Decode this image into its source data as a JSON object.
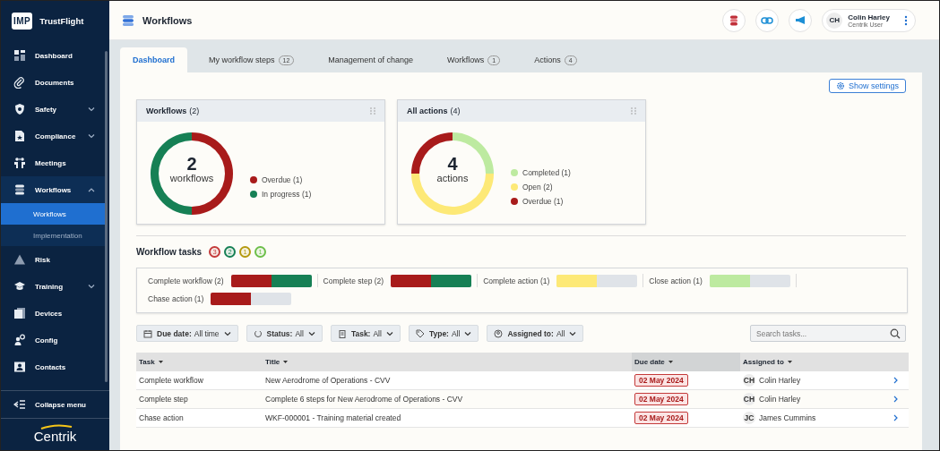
{
  "sidebar": {
    "logo": {
      "mark": "IMP",
      "name": "TrustFlight"
    },
    "items": [
      {
        "label": "Dashboard"
      },
      {
        "label": "Documents"
      },
      {
        "label": "Safety",
        "expanded": false
      },
      {
        "label": "Compliance",
        "expanded": false
      },
      {
        "label": "Meetings"
      },
      {
        "label": "Workflows",
        "expanded": true,
        "children": [
          {
            "label": "Workflows",
            "selected": true
          },
          {
            "label": "Implementation",
            "selected": false
          }
        ]
      },
      {
        "label": "Risk"
      },
      {
        "label": "Training",
        "expanded": false
      },
      {
        "label": "Devices"
      },
      {
        "label": "Config"
      },
      {
        "label": "Contacts"
      }
    ],
    "collapse": "Collapse menu",
    "brand": "Centrik"
  },
  "header": {
    "title": "Workflows",
    "user": {
      "initials": "CH",
      "name": "Colin Harley",
      "role": "Centrik User"
    }
  },
  "tabs": [
    {
      "label": "Dashboard",
      "selected": true
    },
    {
      "label": "My workflow steps",
      "count": "12",
      "selected": false
    },
    {
      "label": "Management of change",
      "selected": false
    },
    {
      "label": "Workflows",
      "count": "1",
      "selected": false
    },
    {
      "label": "Actions",
      "count": "4",
      "selected": false
    }
  ],
  "settings_button": "Show settings",
  "cards": [
    {
      "title": "Workflows",
      "count": "(2)",
      "center_value": "2",
      "center_label": "workflows",
      "chart_data": {
        "type": "donut",
        "categories": [
          "Overdue (1)",
          "In progress (1)"
        ],
        "values": [
          1,
          1
        ],
        "colors": [
          "#a81b1b",
          "#168055"
        ]
      }
    },
    {
      "title": "All actions",
      "count": "(4)",
      "center_value": "4",
      "center_label": "actions",
      "chart_data": {
        "type": "donut",
        "categories": [
          "Completed (1)",
          "Open (2)",
          "Overdue (1)"
        ],
        "values": [
          1,
          2,
          1
        ],
        "colors": [
          "#bdeaa0",
          "#fde977",
          "#a81b1b"
        ]
      }
    }
  ],
  "task_summary": {
    "title": "Workflow tasks",
    "badges": [
      {
        "count": "3",
        "color": "#c43a3a"
      },
      {
        "count": "2",
        "color": "#168055"
      },
      {
        "count": "1",
        "color": "#b59a10"
      },
      {
        "count": "1",
        "color": "#6cbf4a"
      }
    ],
    "items": [
      {
        "label": "Complete workflow (2)",
        "segments": [
          {
            "color": "#a81b1b",
            "level": 0.5
          },
          {
            "color": "#168055",
            "level": 0.5
          }
        ]
      },
      {
        "label": "Complete step (2)",
        "segments": [
          {
            "color": "#a81b1b",
            "level": 0.5
          },
          {
            "color": "#168055",
            "level": 0.5
          }
        ]
      },
      {
        "label": "Complete action (1)",
        "segments": [
          {
            "color": "#fde977",
            "level": 0.5
          }
        ]
      },
      {
        "label": "Close action (1)",
        "segments": [
          {
            "color": "#bdeaa0",
            "level": 0.5
          }
        ]
      },
      {
        "label": "Chase action (1)",
        "segments": [
          {
            "color": "#a81b1b",
            "level": 0.5
          }
        ]
      }
    ]
  },
  "filters": [
    {
      "label": "Due date:",
      "value": "All time"
    },
    {
      "label": "Status:",
      "value": "All"
    },
    {
      "label": "Task:",
      "value": "All"
    },
    {
      "label": "Type:",
      "value": "All"
    },
    {
      "label": "Assigned to:",
      "value": "All"
    }
  ],
  "search": {
    "placeholder": "Search tasks..."
  },
  "table": {
    "columns": [
      {
        "label": "Task",
        "sorted": false
      },
      {
        "label": "Title",
        "sorted": false
      },
      {
        "label": "Due date",
        "sorted": true
      },
      {
        "label": "Assigned to",
        "sorted": false
      }
    ],
    "rows": [
      {
        "task": "Complete workflow",
        "title": "New Aerodrome of Operations - CVV",
        "due": "02 May 2024",
        "initials": "CH",
        "assignee": "Colin Harley"
      },
      {
        "task": "Complete step",
        "title": "Complete 6 steps for New Aerodrome of Operations - CVV",
        "due": "02 May 2024",
        "initials": "CH",
        "assignee": "Colin Harley"
      },
      {
        "task": "Chase action",
        "title": "WKF-000001 - Training material created",
        "due": "02 May 2024",
        "initials": "JC",
        "assignee": "James Cummins"
      }
    ]
  }
}
